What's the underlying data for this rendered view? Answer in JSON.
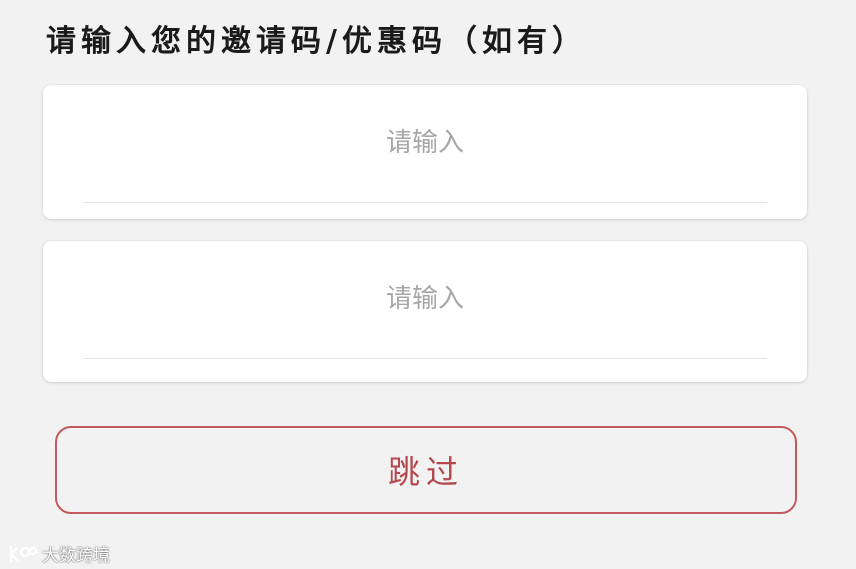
{
  "page": {
    "title": "请输入您的邀请码/优惠码（如有）"
  },
  "inputs": [
    {
      "placeholder": "请输入",
      "value": ""
    },
    {
      "placeholder": "请输入",
      "value": ""
    }
  ],
  "skip_button": {
    "label": "跳过"
  },
  "watermark": {
    "text": "大数跨境"
  },
  "colors": {
    "background": "#f2f2f2",
    "card": "#ffffff",
    "accent": "#b4484c",
    "placeholder": "#a6a6a6"
  }
}
